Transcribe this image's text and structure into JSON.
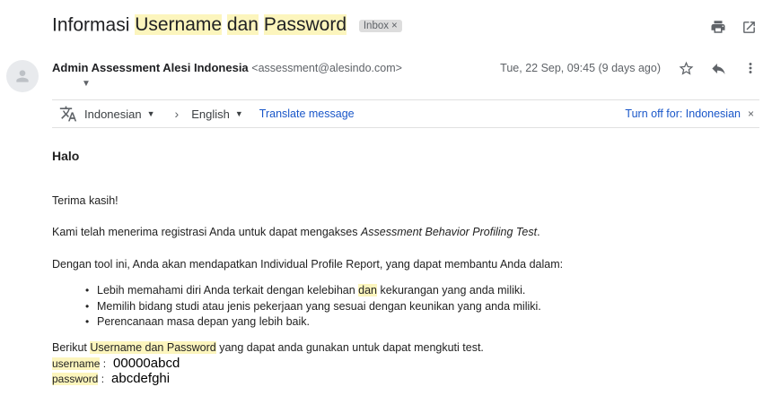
{
  "subject": {
    "pre": "Informasi ",
    "hl1": "Username",
    "mid": " ",
    "hl2": "dan",
    "mid2": " ",
    "hl3": "Password",
    "badge": "Inbox",
    "badge_close": "×"
  },
  "sender": {
    "name": "Admin Assessment Alesi Indonesia",
    "email": "<assessment@alesindo.com>",
    "date": "Tue, 22 Sep, 09:45 (9 days ago)"
  },
  "translate": {
    "from_lang": "Indonesian",
    "to_lang": "English",
    "translate_link": "Translate message",
    "turn_off": "Turn off for: Indonesian",
    "close": "×"
  },
  "message": {
    "greeting": "Halo",
    "thanks": "Terima kasih!",
    "line1_pre": "Kami telah menerima registrasi Anda untuk dapat mengakses ",
    "line1_em": "Assessment Behavior Profiling Test",
    "line1_post": ".",
    "line2": "Dengan tool ini, Anda akan mendapatkan Individual Profile Report, yang dapat membantu Anda dalam:",
    "bullet1_pre": "Lebih memahami diri Anda terkait dengan kelebihan ",
    "bullet1_hl": "dan",
    "bullet1_post": " kekurangan yang anda miliki.",
    "bullet2": "Memilih bidang studi atau jenis pekerjaan yang sesuai dengan keunikan yang anda miliki.",
    "bullet3": "Perencanaan masa depan yang lebih baik.",
    "cred_intro_pre": "Berikut ",
    "cred_intro_hl": "Username dan Password",
    "cred_intro_post": " yang dapat anda gunakan untuk dapat mengkuti test.",
    "username_label": "username",
    "username_sep": " :",
    "username_value": "00000abcd",
    "password_label": "password",
    "password_sep": " :",
    "password_value": "abcdefghi"
  },
  "icons": {
    "print": "print-icon",
    "open_new": "open-in-new-window-icon",
    "star": "star-icon",
    "reply": "reply-icon",
    "more": "more-vert-icon",
    "translate": "translate-icon",
    "avatar": "person-icon"
  }
}
